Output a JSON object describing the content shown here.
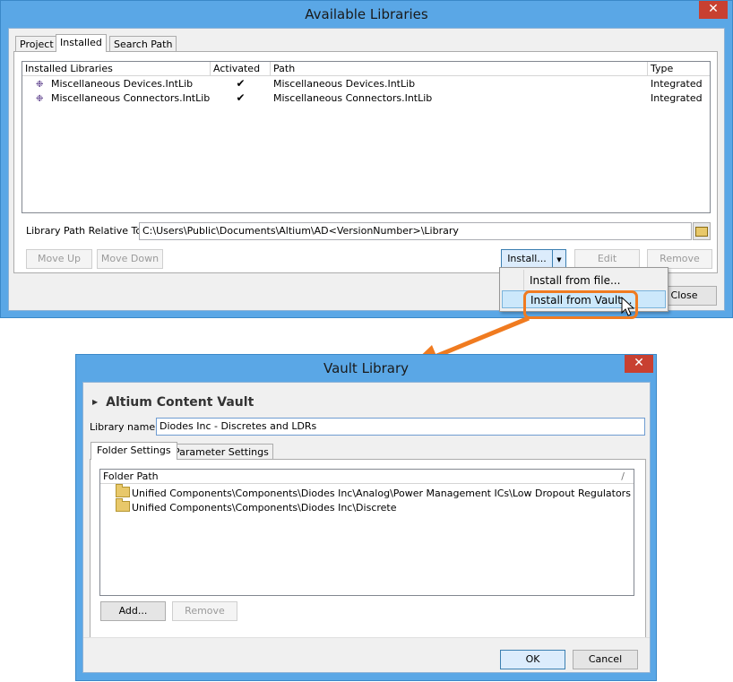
{
  "available_libraries": {
    "title": "Available Libraries",
    "close_glyph": "✕",
    "tabs": [
      {
        "label": "Project"
      },
      {
        "label": "Installed"
      },
      {
        "label": "Search Path"
      }
    ],
    "columns": [
      "Installed Libraries",
      "Activated",
      "Path",
      "Type"
    ],
    "rows": [
      {
        "name": "Miscellaneous Devices.IntLib",
        "activated": "✔",
        "path": "Miscellaneous Devices.IntLib",
        "type": "Integrated"
      },
      {
        "name": "Miscellaneous Connectors.IntLib",
        "activated": "✔",
        "path": "Miscellaneous Connectors.IntLib",
        "type": "Integrated"
      }
    ],
    "library_path_label": "Library Path Relative To:",
    "library_path_value": "C:\\Users\\Public\\Documents\\Altium\\AD<VersionNumber>\\Library",
    "buttons": {
      "move_up": "Move Up",
      "move_down": "Move Down",
      "install": "Install...",
      "edit": "Edit",
      "remove": "Remove",
      "close": "Close"
    },
    "install_menu": {
      "items": [
        "Install from file...",
        "Install from Vault..."
      ]
    }
  },
  "vault_library": {
    "title": "Vault Library",
    "close_glyph": "✕",
    "vault_name": "Altium Content Vault",
    "library_name_label": "Library name:",
    "library_name_value": "Diodes Inc - Discretes and LDRs",
    "tabs": [
      {
        "label": "Folder Settings"
      },
      {
        "label": "Parameter Settings"
      }
    ],
    "folder_path_header": "Folder Path",
    "folder_path_sort_glyph": "/",
    "folders": [
      "Unified Components\\Components\\Diodes Inc\\Analog\\Power Management ICs\\Low Dropout Regulators",
      "Unified Components\\Components\\Diodes Inc\\Discrete"
    ],
    "buttons": {
      "add": "Add...",
      "remove": "Remove",
      "ok": "OK",
      "cancel": "Cancel"
    }
  },
  "colors": {
    "highlight": "#f07b20",
    "window_frame": "#5aa7e6",
    "close_button": "#c84031"
  },
  "icons": [
    "library-icon",
    "checkbox-checked-icon",
    "folder-open-icon",
    "dropdown-arrow-icon",
    "mouse-cursor-icon",
    "expand-triangle-icon",
    "folder-icon",
    "callout-arrow"
  ]
}
